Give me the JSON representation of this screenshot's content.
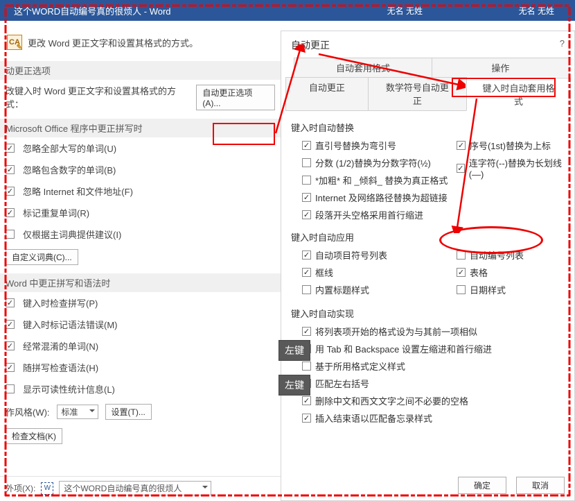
{
  "titlebar": {
    "doc_title": "这个WORD自动编号真的很烦人  -  Word",
    "user1": "无名 无姓",
    "user2": "无名 无姓"
  },
  "left": {
    "header_text": "更改 Word 更正文字和设置其格式的方式。",
    "header_icon": "CA",
    "sec1_title": "动更正选项",
    "sec1_label": "改键入时 Word 更正文字和设置其格式的方式：",
    "sec1_button": "自动更正选项(A)...",
    "sec2_title": "Microsoft Office 程序中更正拼写时",
    "sec2_items": [
      "忽略全部大写的单词(U)",
      "忽略包含数字的单词(B)",
      "忽略 Internet 和文件地址(F)",
      "标记重复单词(R)",
      "仅根据主词典提供建议(I)"
    ],
    "sec2_button": "自定义词典(C)...",
    "sec3_title": "Word 中更正拼写和语法时",
    "sec3_items": [
      "键入时检查拼写(P)",
      "键入时标记语法错误(M)",
      "经常混淆的单词(N)",
      "随拼写检查语法(H)",
      "显示可读性统计信息(L)"
    ],
    "style_label": "作风格(W):",
    "style_value": "标准",
    "style_btn": "设置(T)...",
    "recheck_btn": "检查文档(K)",
    "bottom_label": "外项(X):",
    "bottom_doc": "这个WORD自动编号真的很烦人"
  },
  "right": {
    "title": "自动更正",
    "tabs_top": [
      "自动套用格式",
      "操作"
    ],
    "tabs_bottom": [
      "自动更正",
      "数学符号自动更正",
      "键入时自动套用格式"
    ],
    "sec1_h": "键入时自动替换",
    "sec1_l": [
      "直引号替换为弯引号",
      "分数 (1/2)替换为分数字符(½)",
      "*加粗* 和 _倾斜_ 替换为真正格式",
      "Internet 及网络路径替换为超链接",
      "段落开头空格采用首行缩进"
    ],
    "sec1_r": [
      "序号(1st)替换为上标",
      "连字符(--)替换为长划线(—)"
    ],
    "sec2_h": "键入时自动应用",
    "sec2_l": [
      "自动项目符号列表",
      "框线",
      "内置标题样式"
    ],
    "sec2_r": [
      "自动编号列表",
      "表格",
      "日期样式"
    ],
    "sec3_h": "键入时自动实现",
    "sec3_l": [
      "将列表项开始的格式设为与其前一项相似",
      "用 Tab 和 Backspace 设置左缩进和首行缩进",
      "基于所用格式定义样式",
      "匹配左右括号",
      "删除中文和西文文字之间不必要的空格",
      "插入结束语以匹配备忘录样式"
    ],
    "ok": "确定",
    "cancel": "取消"
  },
  "chart_data": {
    "checkboxes_checked": {
      "left_sec2": [
        true,
        true,
        true,
        true,
        false
      ],
      "left_sec3": [
        true,
        true,
        true,
        true,
        false
      ],
      "right_sec1_l": [
        true,
        false,
        false,
        true,
        true
      ],
      "right_sec1_r": [
        true,
        true
      ],
      "right_sec2_l": [
        true,
        true,
        false
      ],
      "right_sec2_r": [
        false,
        true,
        false
      ],
      "right_sec3_l": [
        true,
        true,
        false,
        true,
        true,
        true
      ]
    }
  },
  "tags": {
    "left1": "左键",
    "left2": "左键"
  }
}
